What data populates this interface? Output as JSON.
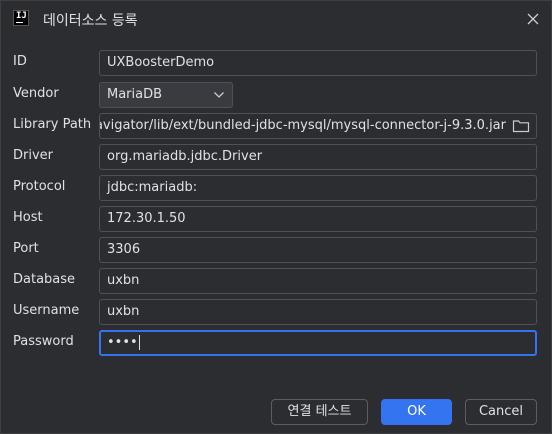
{
  "window": {
    "icon_text": "IJ",
    "title": "데이터소스 등록"
  },
  "form": {
    "id": {
      "label": "ID",
      "value": "UXBoosterDemo"
    },
    "vendor": {
      "label": "Vendor",
      "value": "MariaDB"
    },
    "library_path": {
      "label": "Library Path",
      "value": "avigator/lib/ext/bundled-jdbc-mysql/mysql-connector-j-9.3.0.jar"
    },
    "driver": {
      "label": "Driver",
      "value": "org.mariadb.jdbc.Driver"
    },
    "protocol": {
      "label": "Protocol",
      "value": "jdbc:mariadb:"
    },
    "host": {
      "label": "Host",
      "value": "172.30.1.50"
    },
    "port": {
      "label": "Port",
      "value": "3306"
    },
    "database": {
      "label": "Database",
      "value": "uxbn"
    },
    "username": {
      "label": "Username",
      "value": "uxbn"
    },
    "password": {
      "label": "Password",
      "value": "••••"
    }
  },
  "buttons": {
    "test": "연결 테스트",
    "ok": "OK",
    "cancel": "Cancel"
  },
  "colors": {
    "background": "#2b2d30",
    "field_border": "#4e5157",
    "accent": "#3574f0",
    "text": "#dfe1e5"
  }
}
